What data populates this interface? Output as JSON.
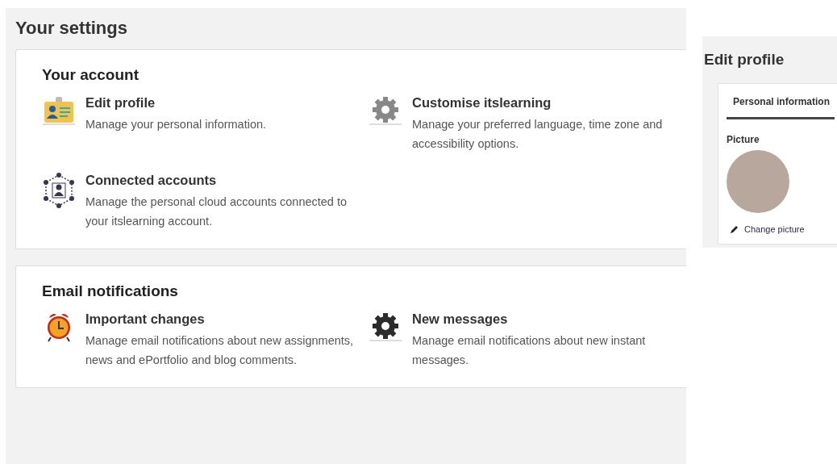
{
  "settings": {
    "title": "Your settings",
    "sections": [
      {
        "title": "Your account",
        "items": [
          {
            "kind": "id-card",
            "title": "Edit profile",
            "description": "Manage your personal information."
          },
          {
            "kind": "gear-grey",
            "title": "Customise itslearning",
            "description": "Manage your preferred language, time zone and accessibility options."
          },
          {
            "kind": "network",
            "title": "Connected accounts",
            "description": "Manage the personal cloud accounts connected to your itslearning account."
          }
        ]
      },
      {
        "title": "Email notifications",
        "items": [
          {
            "kind": "alarm-clock",
            "title": "Important changes",
            "description": "Manage email notifications about new assignments, news and ePortfolio and blog comments."
          },
          {
            "kind": "gear-dark",
            "title": "New messages",
            "description": "Manage email notifications about new instant messages."
          }
        ]
      }
    ]
  },
  "profile": {
    "title": "Edit profile",
    "tabs": [
      {
        "label": "Personal information",
        "selected": true
      }
    ],
    "picture_label": "Picture",
    "change_picture": "Change picture"
  }
}
